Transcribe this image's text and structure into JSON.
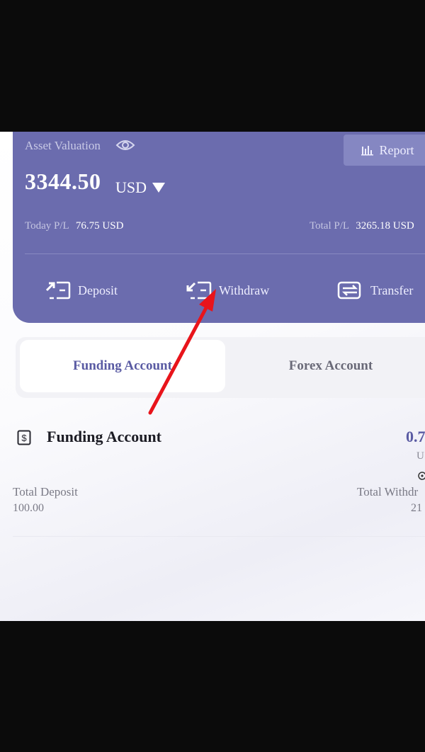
{
  "asset_card": {
    "label": "Asset Valuation",
    "amount": "3344.50",
    "currency": "USD",
    "report_label": "Report",
    "today_pl_label": "Today P/L",
    "today_pl_value": "76.75 USD",
    "total_pl_label": "Total P/L",
    "total_pl_value": "3265.18 USD"
  },
  "actions": {
    "deposit": "Deposit",
    "withdraw": "Withdraw",
    "transfer": "Transfer"
  },
  "tabs": {
    "funding": "Funding Account",
    "forex": "Forex Account"
  },
  "funding_section": {
    "title": "Funding Account",
    "balance": "0.7",
    "balance_unit": "U",
    "total_deposit_label": "Total Deposit",
    "total_deposit_value": "100.00",
    "total_withdraw_label": "Total Withdr",
    "total_withdraw_value": "21"
  },
  "colors": {
    "card": "#6b6cae",
    "accent": "#5a5ba3",
    "annotation_arrow": "#e8141b"
  },
  "icons": [
    "eye-icon",
    "bar-chart-icon",
    "caret-down-icon",
    "deposit-icon",
    "withdraw-icon",
    "transfer-icon",
    "dollar-doc-icon"
  ]
}
